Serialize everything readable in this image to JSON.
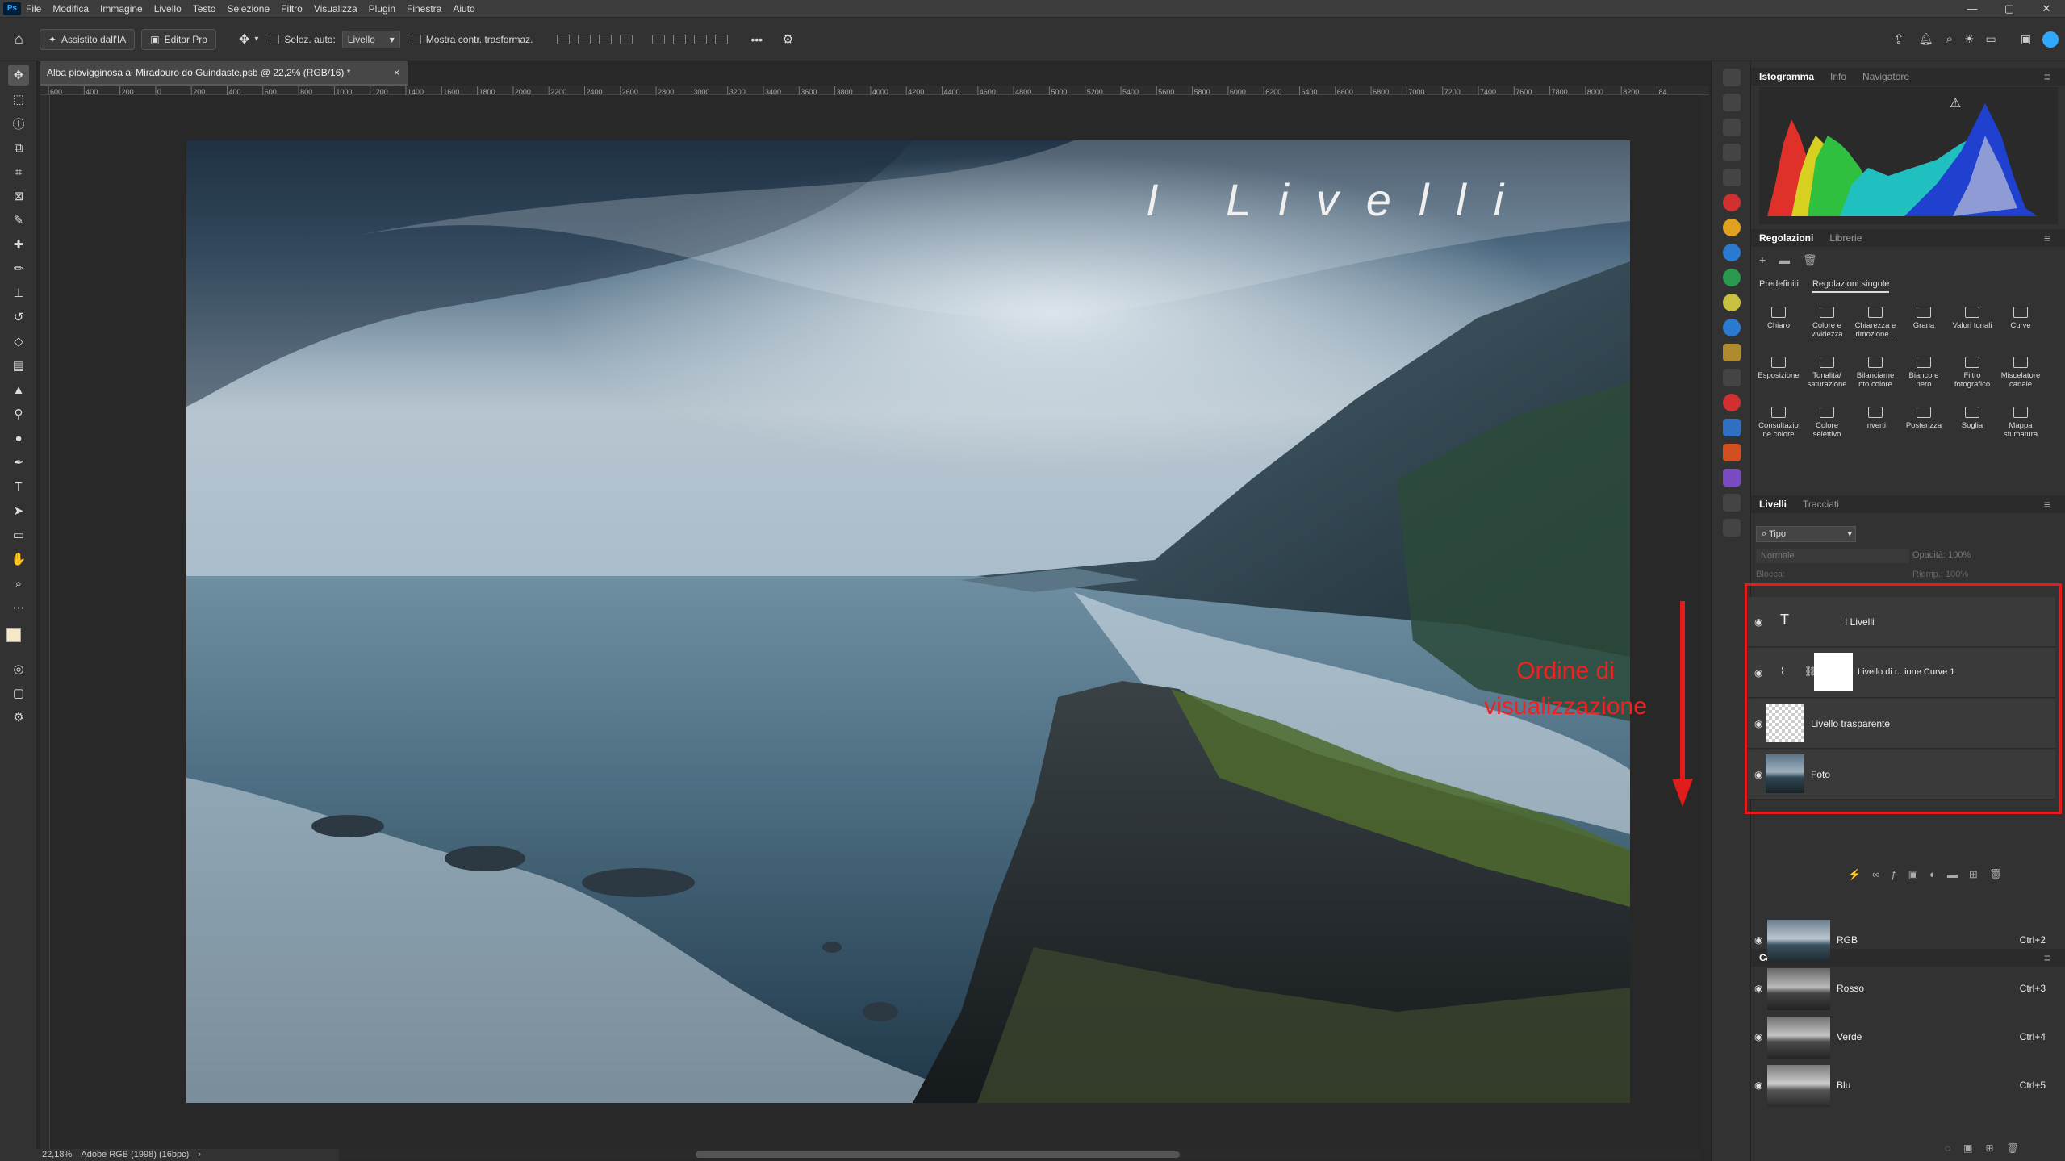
{
  "menu": {
    "logo": "Ps",
    "items": [
      "File",
      "Modifica",
      "Immagine",
      "Livello",
      "Testo",
      "Selezione",
      "Filtro",
      "Visualizza",
      "Plugin",
      "Finestra",
      "Aiuto"
    ]
  },
  "options": {
    "ai_assist": "Assistito dall'IA",
    "editor_pro": "Editor Pro",
    "auto_select": "Selez. auto:",
    "layer_select": "Livello",
    "show_transform": "Mostra contr. trasformaz.",
    "more": "•••"
  },
  "document": {
    "tab_title": "Alba piovigginosa al Miradouro do Guindaste.psb @ 22,2% (RGB/16) *",
    "close": "×"
  },
  "ruler": {
    "labels": [
      "600",
      "400",
      "200",
      "0",
      "200",
      "400",
      "600",
      "800",
      "1000",
      "1200",
      "1400",
      "1600",
      "1800",
      "2000",
      "2200",
      "2400",
      "2600",
      "2800",
      "3000",
      "3200",
      "3400",
      "3600",
      "3800",
      "4000",
      "4200",
      "4400",
      "4600",
      "4800",
      "5000",
      "5200",
      "5400",
      "5600",
      "5800",
      "6000",
      "6200",
      "6400",
      "6600",
      "6800",
      "7000",
      "7200",
      "7400",
      "7600",
      "7800",
      "8000",
      "8200",
      "84"
    ]
  },
  "photo": {
    "title_overlay": "I Livelli"
  },
  "annotation": {
    "text": "Ordine di visualizzazione",
    "color": "#e21b1b"
  },
  "status": {
    "zoom": "22,18%",
    "profile": "Adobe RGB (1998) (16bpc)",
    "arrow": "›"
  },
  "histogram_panel": {
    "tabs": [
      "Istogramma",
      "Info",
      "Navigatore"
    ],
    "warning": "⚠"
  },
  "adjustments_panel": {
    "tabs": [
      "Regolazioni",
      "Librerie"
    ],
    "subtabs": [
      "Predefiniti",
      "Regolazioni singole"
    ],
    "items": [
      [
        "Chiaro"
      ],
      [
        "Colore e",
        "vividezza"
      ],
      [
        "Chiarezza e",
        "rimozione..."
      ],
      [
        "Grana"
      ],
      [
        "Valori tonali"
      ],
      [
        "Curve"
      ],
      [
        "Esposizione"
      ],
      [
        "Tonalità/",
        "saturazione"
      ],
      [
        "Bilanciame",
        "nto colore"
      ],
      [
        "Bianco e",
        "nero"
      ],
      [
        "Filtro",
        "fotografico"
      ],
      [
        "Miscelatore",
        "canale"
      ],
      [
        "Consultazio",
        "ne colore"
      ],
      [
        "Colore",
        "selettivo"
      ],
      [
        "Inverti"
      ],
      [
        "Posterizza"
      ],
      [
        "Soglia"
      ],
      [
        "Mappa",
        "sfumatura"
      ]
    ]
  },
  "layers_panel": {
    "tabs": [
      "Livelli",
      "Tracciati"
    ],
    "filter": "Tipo",
    "blend": "Normale",
    "opacity_label": "Opacità:",
    "opacity": "100%",
    "lock_label": "Blocca:",
    "fill_label": "Riemp.:",
    "fill": "100%",
    "layers": [
      {
        "name": "I Livelli",
        "kind": "text",
        "glyph": "T"
      },
      {
        "name": "Livello di r...ione Curve 1",
        "kind": "adjustment"
      },
      {
        "name": "Livello trasparente",
        "kind": "transparent"
      },
      {
        "name": "Foto",
        "kind": "photo"
      }
    ]
  },
  "channels_panel": {
    "title": "Canali",
    "channels": [
      {
        "name": "RGB",
        "shortcut": "Ctrl+2"
      },
      {
        "name": "Rosso",
        "shortcut": "Ctrl+3"
      },
      {
        "name": "Verde",
        "shortcut": "Ctrl+4"
      },
      {
        "name": "Blu",
        "shortcut": "Ctrl+5"
      }
    ]
  },
  "colors": {
    "accent": "#31a8ff",
    "highlight_red": "#e21b1b"
  }
}
